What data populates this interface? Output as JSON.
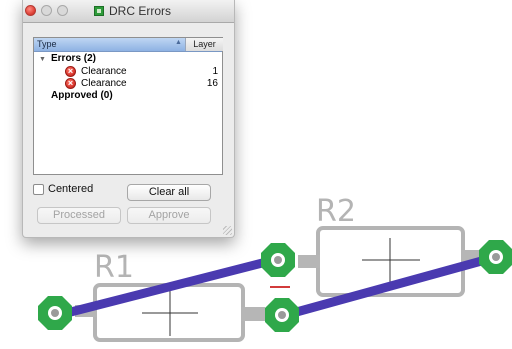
{
  "window": {
    "title": "DRC Errors",
    "columns": {
      "type": "Type",
      "layer": "Layer"
    },
    "tree": {
      "errors_label": "Errors (2)",
      "errors": [
        {
          "label": "Clearance",
          "count": "1"
        },
        {
          "label": "Clearance",
          "count": "16"
        }
      ],
      "approved_label": "Approved (0)"
    },
    "centered_label": "Centered",
    "centered_checked": false,
    "buttons": {
      "clear_all": "Clear all",
      "processed": "Processed",
      "approve": "Approve"
    }
  },
  "board": {
    "parts": [
      {
        "name": "R1"
      },
      {
        "name": "R2"
      }
    ],
    "colors": {
      "trace": "#4a3ab0",
      "pad_ring": "#2fa84a",
      "silkscreen": "#b0b0b0",
      "error_marker": "#d23b3b"
    }
  }
}
